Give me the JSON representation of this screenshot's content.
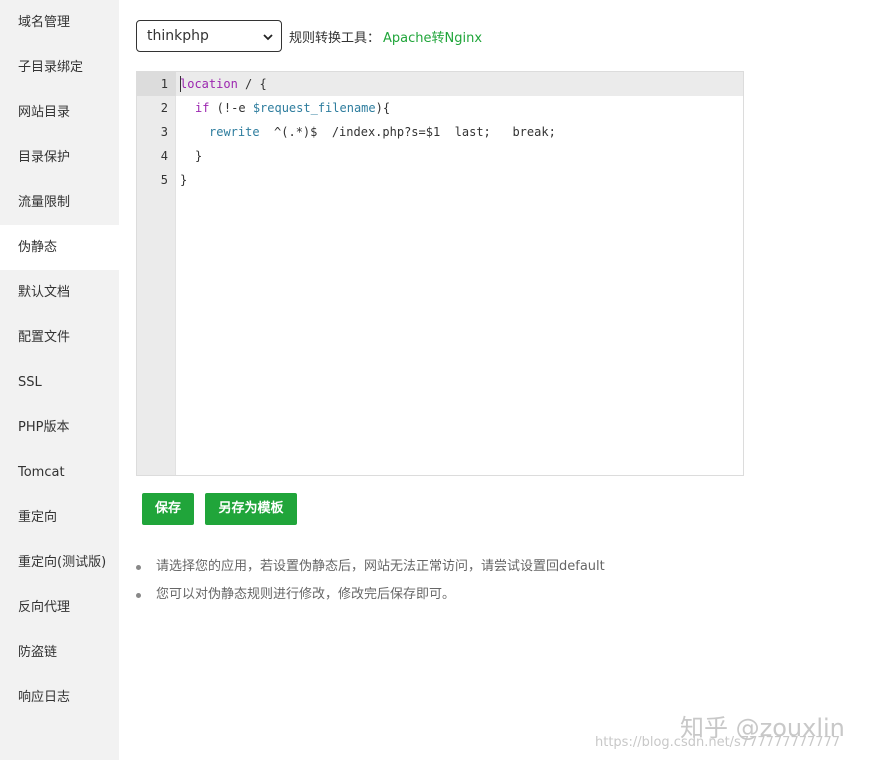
{
  "sidebar": {
    "items": [
      {
        "label": "域名管理"
      },
      {
        "label": "子目录绑定"
      },
      {
        "label": "网站目录"
      },
      {
        "label": "目录保护"
      },
      {
        "label": "流量限制"
      },
      {
        "label": "伪静态",
        "active": true
      },
      {
        "label": "默认文档"
      },
      {
        "label": "配置文件"
      },
      {
        "label": "SSL"
      },
      {
        "label": "PHP版本"
      },
      {
        "label": "Tomcat"
      },
      {
        "label": "重定向"
      },
      {
        "label": "重定向(测试版)"
      },
      {
        "label": "反向代理"
      },
      {
        "label": "防盗链"
      },
      {
        "label": "响应日志"
      }
    ]
  },
  "rewrite": {
    "selected": "thinkphp",
    "tool_label": "规则转换工具：",
    "tool_link": "Apache转Nginx"
  },
  "editor": {
    "line_numbers": [
      "1",
      "2",
      "3",
      "4",
      "5"
    ],
    "lines": {
      "l1_kw": "location",
      "l1_rest": " / {",
      "l2_kw": "if",
      "l2_mid": " (!-e ",
      "l2_var": "$request_filename",
      "l2_end": "){",
      "l3_fn": "rewrite",
      "l3_rest": "  ^(.*)$  /index.php?s=$1  last;   break;",
      "l4": "}",
      "l5": "}"
    }
  },
  "buttons": {
    "save": "保存",
    "save_template": "另存为模板"
  },
  "tips": [
    "请选择您的应用，若设置伪静态后，网站无法正常访问，请尝试设置回default",
    "您可以对伪静态规则进行修改，修改完后保存即可。"
  ],
  "watermark": {
    "brand": "知乎 @zouxlin",
    "url": "https://blog.csdn.net/s777777777777"
  },
  "colors": {
    "accent": "#20a53a",
    "keyword": "#9c27b0",
    "function": "#2e7d9e"
  }
}
